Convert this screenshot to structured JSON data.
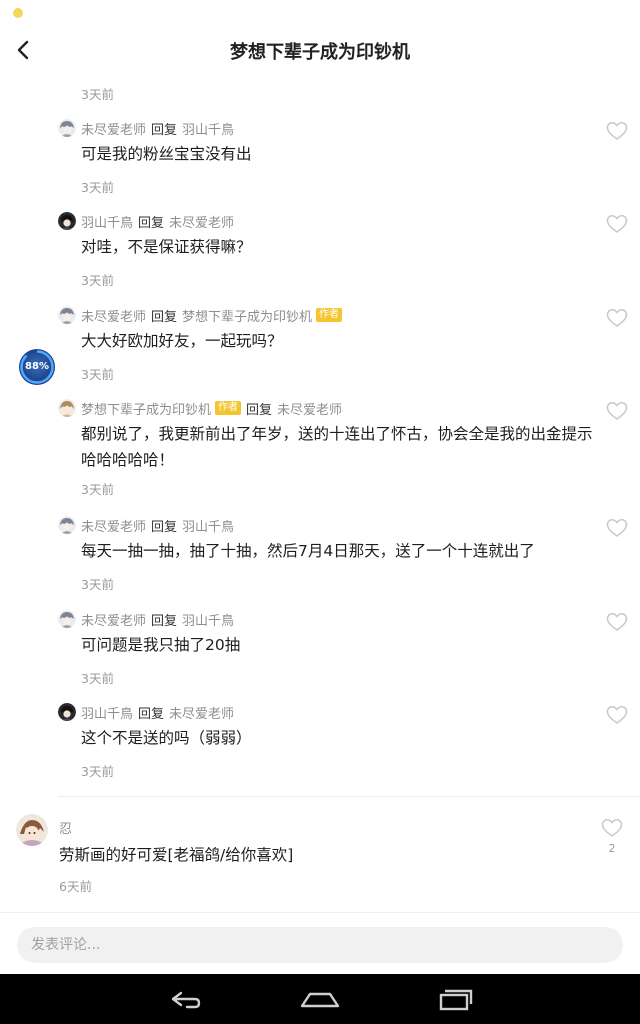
{
  "header": {
    "title": "梦想下辈子成为印钞机"
  },
  "top_timestamp": "3天前",
  "replies": [
    {
      "user": "未尽爱老师",
      "reply_word": "回复",
      "target": "羽山千鳥",
      "author_badge_on_user": false,
      "author_badge_on_target": false,
      "text": "可是我的粉丝宝宝没有出",
      "time": "3天前",
      "avatar_icon": "avatar-gray-icon"
    },
    {
      "user": "羽山千鳥",
      "reply_word": "回复",
      "target": "未尽爱老师",
      "author_badge_on_user": false,
      "author_badge_on_target": false,
      "text": "对哇，不是保证获得嘛？",
      "time": "3天前",
      "avatar_icon": "avatar-dark-icon"
    },
    {
      "user": "未尽爱老师",
      "reply_word": "回复",
      "target": "梦想下辈子成为印钞机",
      "author_badge_on_user": false,
      "author_badge_on_target": true,
      "text": "大大好欧加好友，一起玩吗？",
      "time": "3天前",
      "avatar_icon": "avatar-gray-icon"
    },
    {
      "user": "梦想下辈子成为印钞机",
      "reply_word": "回复",
      "target": "未尽爱老师",
      "author_badge_on_user": true,
      "author_badge_on_target": false,
      "text": "都别说了，我更新前出了年岁，送的十连出了怀古，协会全是我的出金提示哈哈哈哈哈！",
      "time": "3天前",
      "avatar_icon": "avatar-anime-icon"
    },
    {
      "user": "未尽爱老师",
      "reply_word": "回复",
      "target": "羽山千鳥",
      "author_badge_on_user": false,
      "author_badge_on_target": false,
      "text": "每天一抽一抽，抽了十抽，然后7月4日那天，送了一个十连就出了",
      "time": "3天前",
      "avatar_icon": "avatar-gray-icon"
    },
    {
      "user": "未尽爱老师",
      "reply_word": "回复",
      "target": "羽山千鳥",
      "author_badge_on_user": false,
      "author_badge_on_target": false,
      "text": "可问题是我只抽了20抽",
      "time": "3天前",
      "avatar_icon": "avatar-gray-icon"
    },
    {
      "user": "羽山千鳥",
      "reply_word": "回复",
      "target": "未尽爱老师",
      "author_badge_on_user": false,
      "author_badge_on_target": false,
      "text": "这个不是送的吗（弱弱）",
      "time": "3天前",
      "avatar_icon": "avatar-dark-icon"
    }
  ],
  "author_badge_label": "作者",
  "comment": {
    "user": "忍",
    "text": "劳斯画的好可爱[老福鸽/给你喜欢]",
    "time": "6天前",
    "likes": "2"
  },
  "floating_badge": {
    "label": "88%",
    "progress": 0.88
  },
  "composer": {
    "placeholder": "发表评论..."
  },
  "icons": {
    "back": "back-arrow-icon",
    "like": "heart-outline-icon",
    "nav_back": "nav-back-icon",
    "nav_home": "nav-home-icon",
    "nav_recents": "nav-recents-icon"
  },
  "colors": {
    "author_badge": "#f5c52f",
    "status_dot": "#f3d860",
    "badge_ring": "#2f7de1"
  }
}
